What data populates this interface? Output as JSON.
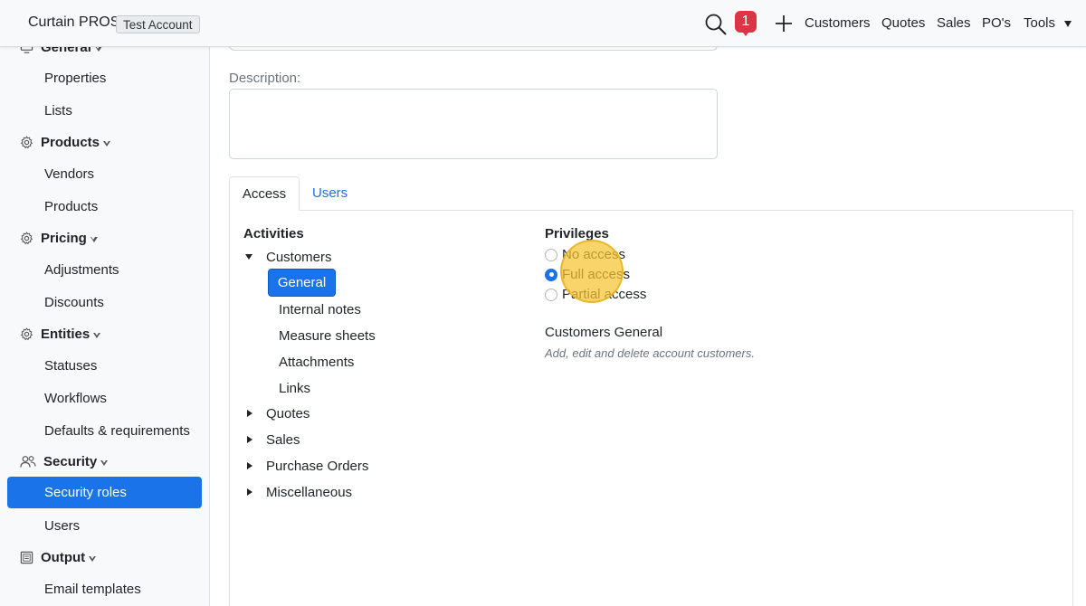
{
  "header": {
    "brand": "Curtain PROS",
    "account_badge": "Test Account",
    "notification_count": "1",
    "nav": [
      "Customers",
      "Quotes",
      "Sales",
      "PO's",
      "Tools"
    ]
  },
  "sidebar": {
    "general_header": "General",
    "general_items": [
      "Properties",
      "Lists"
    ],
    "products_header": "Products",
    "products_items": [
      "Vendors",
      "Products"
    ],
    "pricing_header": "Pricing",
    "pricing_items": [
      "Adjustments",
      "Discounts"
    ],
    "entities_header": "Entities",
    "entities_items": [
      "Statuses",
      "Workflows",
      "Defaults & requirements"
    ],
    "security_header": "Security",
    "security_items": [
      "Security roles",
      "Users"
    ],
    "output_header": "Output",
    "output_items": [
      "Email templates"
    ]
  },
  "form": {
    "description_label": "Description:",
    "description_value": ""
  },
  "tabs": [
    "Access",
    "Users"
  ],
  "activities": {
    "title": "Activities",
    "customers": "Customers",
    "customers_children": [
      "General",
      "Internal notes",
      "Measure sheets",
      "Attachments",
      "Links"
    ],
    "collapsed": [
      "Quotes",
      "Sales",
      "Purchase Orders",
      "Miscellaneous"
    ]
  },
  "privileges": {
    "title": "Privileges",
    "options": [
      "No access",
      "Full access",
      "Partial access"
    ],
    "selected": "Full access",
    "detail_title": "Customers General",
    "detail_text": "Add, edit and delete account customers."
  },
  "colors": {
    "accent": "#1a73e8",
    "notification": "#dc3545",
    "cursor_highlight": "#f6c430"
  }
}
